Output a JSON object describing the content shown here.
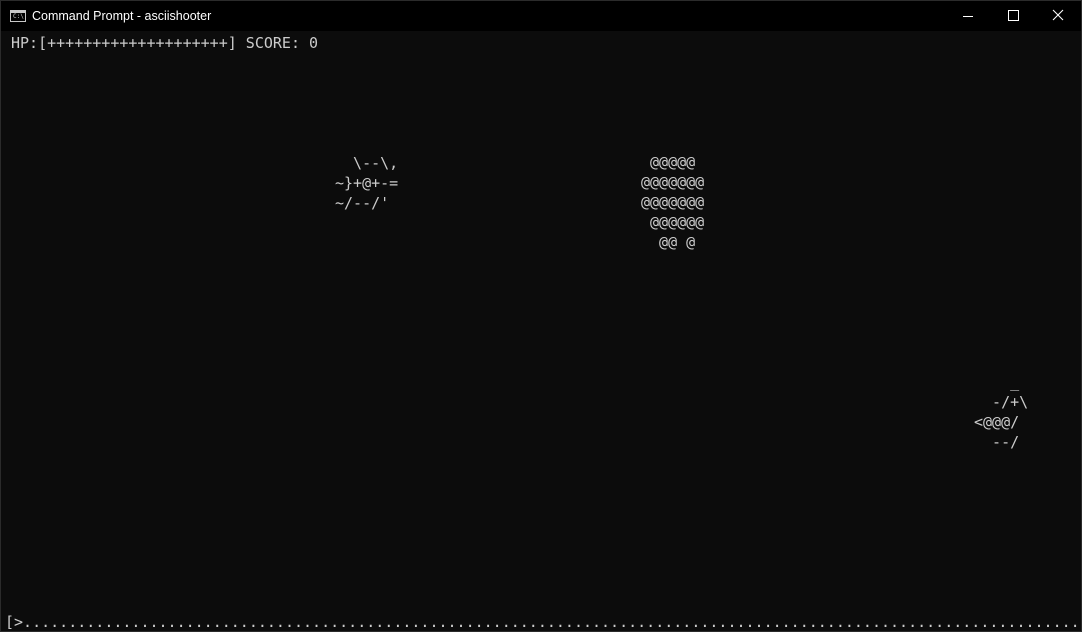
{
  "window": {
    "title": "Command Prompt - asciishooter",
    "icon": "cmd-icon",
    "icon_glyph": "C:\\"
  },
  "controls": {
    "minimize": "minimize-icon",
    "maximize": "maximize-icon",
    "close": "close-icon"
  },
  "hud": {
    "text": "HP:[++++++++++++++++++++] SCORE: 0",
    "hp_segments": 20,
    "score": 0
  },
  "sprites": {
    "enemy_ship": "  \\--\\,\n~}+@+-=\n~/--/'",
    "asteroid": " @@@@@\n@@@@@@@\n@@@@@@@\n @@@@@@\n  @@ @",
    "player_ship": "    _\n  -/+\\\n<@@@/\n  --/"
  },
  "bottom_bar": {
    "text": "[>.....................................................................................................................................B]"
  },
  "colors": {
    "background": "#0c0c0c",
    "titlebar": "#000000",
    "text": "#cccccc",
    "title_text": "#ffffff"
  }
}
